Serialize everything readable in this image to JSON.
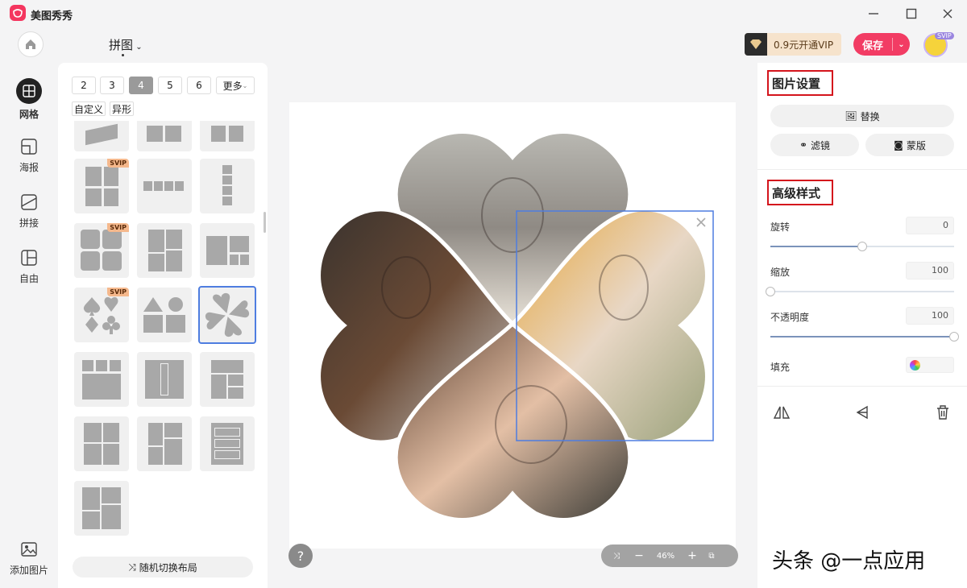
{
  "app": {
    "name": "美图秀秀"
  },
  "header": {
    "mode_title": "拼图",
    "vip_label": "0.9元开通VIP",
    "save_label": "保存",
    "svip_badge": "SVIP"
  },
  "nav": {
    "items": [
      {
        "label": "网格",
        "icon": "grid-icon",
        "active": true
      },
      {
        "label": "海报",
        "icon": "poster-icon",
        "active": false
      },
      {
        "label": "拼接",
        "icon": "stitch-icon",
        "active": false
      },
      {
        "label": "自由",
        "icon": "free-layout-icon",
        "active": false
      }
    ],
    "add_image_label": "添加图片"
  },
  "layouts": {
    "counts": [
      "2",
      "3",
      "4",
      "5",
      "6"
    ],
    "active_count": "4",
    "more_label": "更多",
    "tags": [
      "自定义",
      "异形"
    ],
    "svip_tag": "SVIP",
    "random_label": "随机切换布局"
  },
  "canvas": {
    "zoom": "46%",
    "help": "?"
  },
  "right_panel": {
    "image_settings_title": "图片设置",
    "replace_label": "替换",
    "filter_label": "滤镜",
    "mask_label": "蒙版",
    "advanced_title": "高级样式",
    "rotate_label": "旋转",
    "rotate_value": "0",
    "rotate_level": 0.5,
    "scale_label": "缩放",
    "scale_value": "100",
    "scale_level": 0.0,
    "opacity_label": "不透明度",
    "opacity_value": "100",
    "opacity_level": 1.0,
    "fill_label": "填充"
  },
  "watermark": "头条 @一点应用",
  "colors": {
    "accent": "#f23c64",
    "selection": "#4e7de0",
    "highlight_box": "#d4141c"
  }
}
